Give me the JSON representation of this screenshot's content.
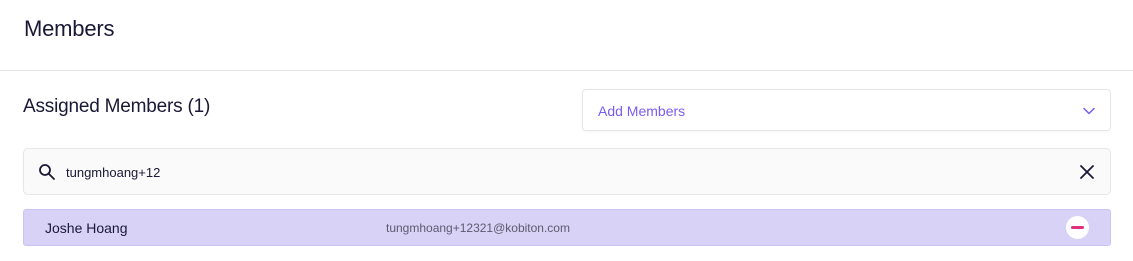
{
  "page": {
    "title": "Members"
  },
  "assigned": {
    "title": "Assigned Members (1)",
    "add_members_label": "Add Members"
  },
  "search": {
    "value": "tungmhoang+12",
    "icons": {
      "search": "search-icon",
      "clear": "close-icon"
    }
  },
  "members": [
    {
      "name": "Joshe Hoang",
      "email": "tungmhoang+12321@kobiton.com"
    }
  ],
  "colors": {
    "accent": "#7a5cf0",
    "row_highlight": "#d8d2f6",
    "remove": "#e0327a"
  }
}
